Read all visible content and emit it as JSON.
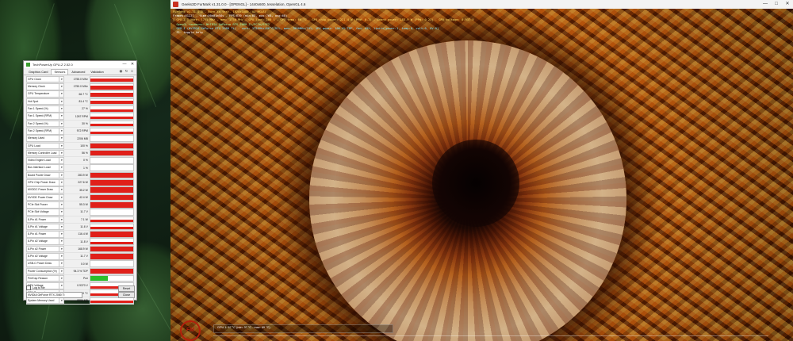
{
  "furmark": {
    "title": "Geeks3D FurMark v1.31.0.0 - [OPENGL] - 1440x600, tesselation, OpenGL 4.6",
    "osd_lines": [
      "FurMark v1.31.0.0 - Burn-in test, 1920x1080 (0X MSAA)",
      "Frames:61227 - time:00h01m58s - FPS:639 (min:63, max:768, avg:68)",
      "[ GPU-Z ] core: 1755 MHz - mem: 1750 MHz - GPU load: 100 % - GPU temp: 66 °C - GPU chip power: 221.4 W (PPW: 0.3) - Board power: 283.9 W (PPW: 0.23) - GPU voltage: 0.937 V",
      "- OpenGL renderer: NVIDIA GeForce RTX 2080 Ti/PCIe/SSE2",
      "- GPU 1 (NVIDIA GeForce RTX 2080 Ti) - core: 1755MHz/66°C/91%, mem: 7000MHz/13%, GPU power: 100.4% TDP, fan: 45%, limits[power:1, temp:0, volt:0, OV:0]",
      "- F1: toggle help"
    ],
    "graph_label": "GPU 1: 67 °C (min: 37 °C - max: 69 °C)",
    "logo": "FM"
  },
  "gpuz": {
    "title": "TechPowerUp GPU-Z 2.52.0",
    "tabs": [
      "Graphics Card",
      "Sensors",
      "Advanced",
      "Validation"
    ],
    "active_tab": "Sensors",
    "sensors": [
      {
        "label": "GPU Clock",
        "value": "1755.0 MHz",
        "level": "mid"
      },
      {
        "label": "Memory Clock",
        "value": "1750.0 MHz",
        "level": "mid"
      },
      {
        "label": "GPU Temperature",
        "value": "66.7 °C",
        "level": "mid"
      },
      {
        "label": "Hot Spot",
        "value": "81.4 °C",
        "level": "mid"
      },
      {
        "label": "Fan 1 Speed (%)",
        "value": "27 %",
        "level": "low"
      },
      {
        "label": "Fan 1 Speed (RPM)",
        "value": "1267 RPM",
        "level": "low"
      },
      {
        "label": "Fan 2 Speed (%)",
        "value": "30 %",
        "level": "low"
      },
      {
        "label": "Fan 2 Speed (RPM)",
        "value": "972 RPM",
        "level": "low"
      },
      {
        "label": "Memory Used",
        "value": "2206 MB",
        "level": "none"
      },
      {
        "label": "GPU Load",
        "value": "100 %",
        "level": "full"
      },
      {
        "label": "Memory Controller Load",
        "value": "56 %",
        "level": "full"
      },
      {
        "label": "Video Engine Load",
        "value": "0 %",
        "level": "none"
      },
      {
        "label": "Bus Interface Load",
        "value": "1 %",
        "level": "none"
      },
      {
        "label": "Board Power Draw",
        "value": "283.9 W",
        "level": "full"
      },
      {
        "label": "GPU Chip Power Draw",
        "value": "227.6 W",
        "level": "full"
      },
      {
        "label": "MVDDC Power Draw",
        "value": "35.2 W",
        "level": "full"
      },
      {
        "label": "NVVDD Power Draw",
        "value": "42.4 W",
        "level": "full"
      },
      {
        "label": "PCIe Slot Power",
        "value": "55.3 W",
        "level": "full"
      },
      {
        "label": "PCIe Slot Voltage",
        "value": "11.7 V",
        "level": "none"
      },
      {
        "label": "8-Pin #1 Power",
        "value": "7.1 W",
        "level": "low"
      },
      {
        "label": "8-Pin #1 Voltage",
        "value": "11.6 V",
        "level": "low"
      },
      {
        "label": "8-Pin #1 Power",
        "value": "116.4 W",
        "level": "full"
      },
      {
        "label": "8-Pin #2 Voltage",
        "value": "11.8 V",
        "level": "low"
      },
      {
        "label": "8-Pin #2 Power",
        "value": "168.9 W",
        "level": "full"
      },
      {
        "label": "8-Pin #2 Voltage",
        "value": "11.7 V",
        "level": "full"
      },
      {
        "label": "USB-C Power Draw",
        "value": "0.0 W",
        "level": "none"
      },
      {
        "label": "Power Consumption (%)",
        "value": "94.3 % TDP",
        "level": "full"
      },
      {
        "label": "PerfCap Reason",
        "value": "Pwr",
        "level": "green"
      },
      {
        "label": "GPU Voltage",
        "value": "0.9370 V",
        "level": "low"
      },
      {
        "label": "CPU Temperature",
        "value": "53.0 °C",
        "level": "low"
      },
      {
        "label": "System Memory Used",
        "value": "8886 MB",
        "level": "low"
      }
    ],
    "log_label": "Log to file",
    "reset_label": "Reset",
    "close_label": "Close",
    "device": "NVIDIA GeForce RTX 2080 Ti"
  }
}
